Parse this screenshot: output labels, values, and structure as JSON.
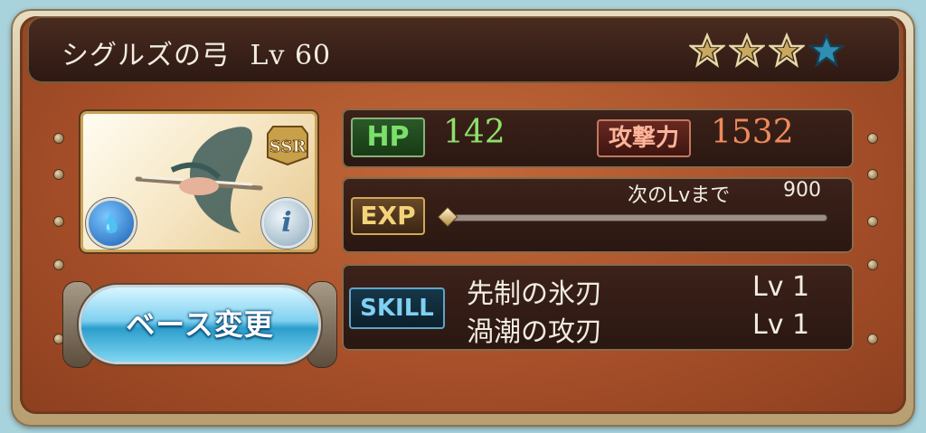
{
  "weapon": {
    "name": "シグルズの弓",
    "level_text": "Lv 60",
    "rarity": "SSR",
    "element": "water",
    "stars_filled": 3,
    "stars_total": 4
  },
  "stats": {
    "hp_label": "HP",
    "hp_value": "142",
    "atk_label": "攻撃力",
    "atk_value": "1532"
  },
  "exp": {
    "label": "EXP",
    "next_text": "次のLvまで",
    "next_value": "900",
    "progress": 0.0
  },
  "skills": {
    "label": "SKILL",
    "items": [
      {
        "name": "先制の氷刃",
        "level": "Lv 1"
      },
      {
        "name": "渦潮の攻刃",
        "level": "Lv 1"
      }
    ]
  },
  "actions": {
    "base_change_label": "ベース変更"
  },
  "icons": {
    "element": "water-element-icon",
    "info": "info-icon",
    "star": "star-icon"
  },
  "colors": {
    "hp": "#8ee06a",
    "attack": "#f08a5a",
    "skill_tag": "#7fd0f3",
    "star_filled": "#d9c07a",
    "star_empty": "#2f8fb3"
  }
}
